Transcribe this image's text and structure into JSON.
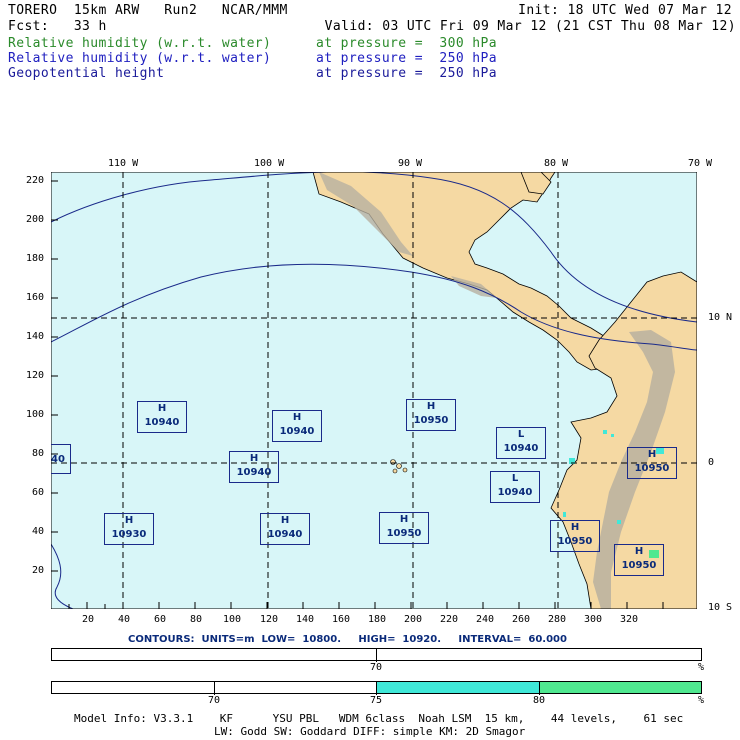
{
  "header": {
    "left1": "TORERO  15km ARW   Run2   NCAR/MMM",
    "right1": "Init: 18 UTC Wed 07 Mar 12",
    "left2": "Fcst:   33 h",
    "right2": "Valid: 03 UTC Fri 09 Mar 12 (21 CST Thu 08 Mar 12)",
    "fields": [
      {
        "name": "Relative humidity (w.r.t. water)",
        "level": "at pressure =  300 hPa",
        "color": "#2a8a2a"
      },
      {
        "name": "Relative humidity (w.r.t. water)",
        "level": "at pressure =  250 hPa",
        "color": "#2020c0"
      },
      {
        "name": "Geopotential height",
        "level": "at pressure =  250 hPa",
        "color": "#1a1a9a"
      }
    ]
  },
  "map": {
    "top_lon_labels": [
      "110 W",
      "100 W",
      "90 W",
      "80 W",
      "70 W"
    ],
    "right_lat_labels": [
      "10 N",
      "0",
      "10 S"
    ],
    "y_ticks": [
      "220",
      "200",
      "180",
      "160",
      "140",
      "120",
      "100",
      "80",
      "60",
      "40",
      "20"
    ],
    "x_ticks": [
      "20",
      "40",
      "60",
      "80",
      "100",
      "120",
      "140",
      "160",
      "180",
      "200",
      "220",
      "240",
      "260",
      "280",
      "300",
      "320"
    ],
    "colors": {
      "ocean": "#d8f6f8",
      "land": "#f5d9a3",
      "mountain": "#b8b0a0",
      "rh_high": "#40e8d8",
      "rh_mid": "#50e890",
      "contour": "#1a2a8a"
    }
  },
  "highs_lows": [
    {
      "type": "H",
      "value": "10940"
    },
    {
      "type": "H",
      "value": "10940"
    },
    {
      "type": "H",
      "value": "10950"
    },
    {
      "type": "L",
      "value": "10940"
    },
    {
      "type": "H",
      "value": "10940"
    },
    {
      "type": "H",
      "value": "10950"
    },
    {
      "type": "L",
      "value": "10940"
    },
    {
      "type": "H",
      "value": "10930"
    },
    {
      "type": "H",
      "value": "10940"
    },
    {
      "type": "H",
      "value": "10950"
    },
    {
      "type": "H",
      "value": "10950"
    },
    {
      "type": "H",
      "value": "10950"
    },
    {
      "type": "",
      "value": "40"
    }
  ],
  "contours_line": "CONTOURS:  UNITS=m  LOW=  10800.     HIGH=  10920.     INTERVAL=  60.000",
  "bar1": {
    "label": "70",
    "unit": "%"
  },
  "bar2": {
    "labels": [
      "70",
      "75",
      "80"
    ],
    "unit": "%",
    "segments": [
      {
        "from": 75,
        "to": 80,
        "color": "#40e8d8"
      },
      {
        "from": 80,
        "to": 100,
        "color": "#50e890"
      }
    ]
  },
  "footer": {
    "line1": "Model Info: V3.3.1    KF      YSU PBL   WDM 6class  Noah LSM  15 km,    44 levels,    61 sec",
    "line2": "LW: Godd SW: Goddard DIFF: simple KM: 2D Smagor"
  }
}
